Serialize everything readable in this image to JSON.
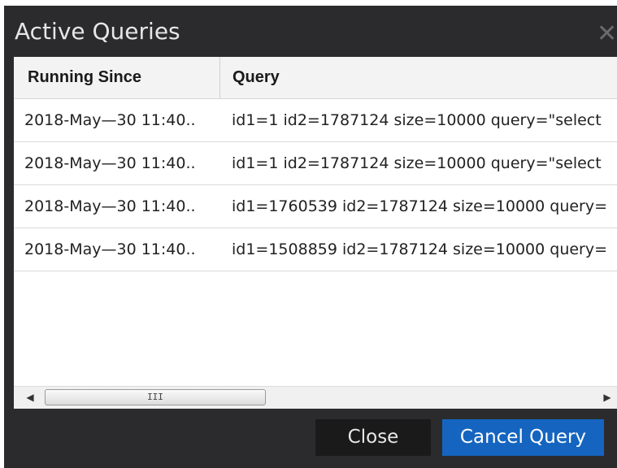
{
  "dialog": {
    "title": "Active Queries",
    "close_icon": "close-icon"
  },
  "table": {
    "columns": [
      "Running Since",
      "Query"
    ],
    "rows": [
      {
        "running_since": "2018-May—30 11:40..",
        "query": "id1=1 id2=1787124 size=10000 query=\"select"
      },
      {
        "running_since": "2018-May—30 11:40..",
        "query": "id1=1 id2=1787124 size=10000 query=\"select"
      },
      {
        "running_since": "2018-May—30 11:40..",
        "query": "id1=1760539 id2=1787124 size=10000 query="
      },
      {
        "running_since": "2018-May—30 11:40..",
        "query": "id1=1508859 id2=1787124 size=10000 query="
      }
    ]
  },
  "scrollbar": {
    "grip": "III"
  },
  "buttons": {
    "close": "Close",
    "cancel_query": "Cancel Query"
  },
  "colors": {
    "dialog_bg": "#2b2b2d",
    "primary_button": "#1565c0"
  }
}
